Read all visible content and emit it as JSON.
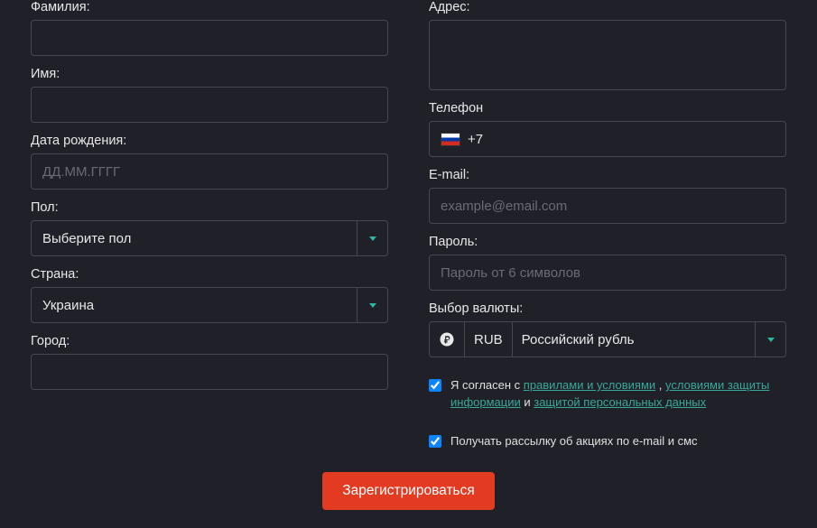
{
  "left": {
    "lastname_label": "Фамилия:",
    "firstname_label": "Имя:",
    "dob_label": "Дата рождения:",
    "dob_placeholder": "ДД.ММ.ГГГГ",
    "gender_label": "Пол:",
    "gender_value": "Выберите пол",
    "country_label": "Страна:",
    "country_value": "Украина",
    "city_label": "Город:"
  },
  "right": {
    "address_label": "Адрес:",
    "phone_label": "Телефон",
    "phone_code": "+7",
    "email_label": "E-mail:",
    "email_placeholder": "example@email.com",
    "password_label": "Пароль:",
    "password_placeholder": "Пароль от 6 символов",
    "currency_label": "Выбор валюты:",
    "currency_code": "RUB",
    "currency_name": "Российский рубль"
  },
  "consent": {
    "prefix": "Я согласен с ",
    "rules": "правилами и условиями",
    "comma": " , ",
    "privacy": "условиями защиты информации",
    "and": " и ",
    "data": "защитой персональных данных"
  },
  "newsletter": {
    "label": "Получать рассылку об акциях по e-mail и смс"
  },
  "submit": {
    "label": "Зарегистрироваться"
  }
}
